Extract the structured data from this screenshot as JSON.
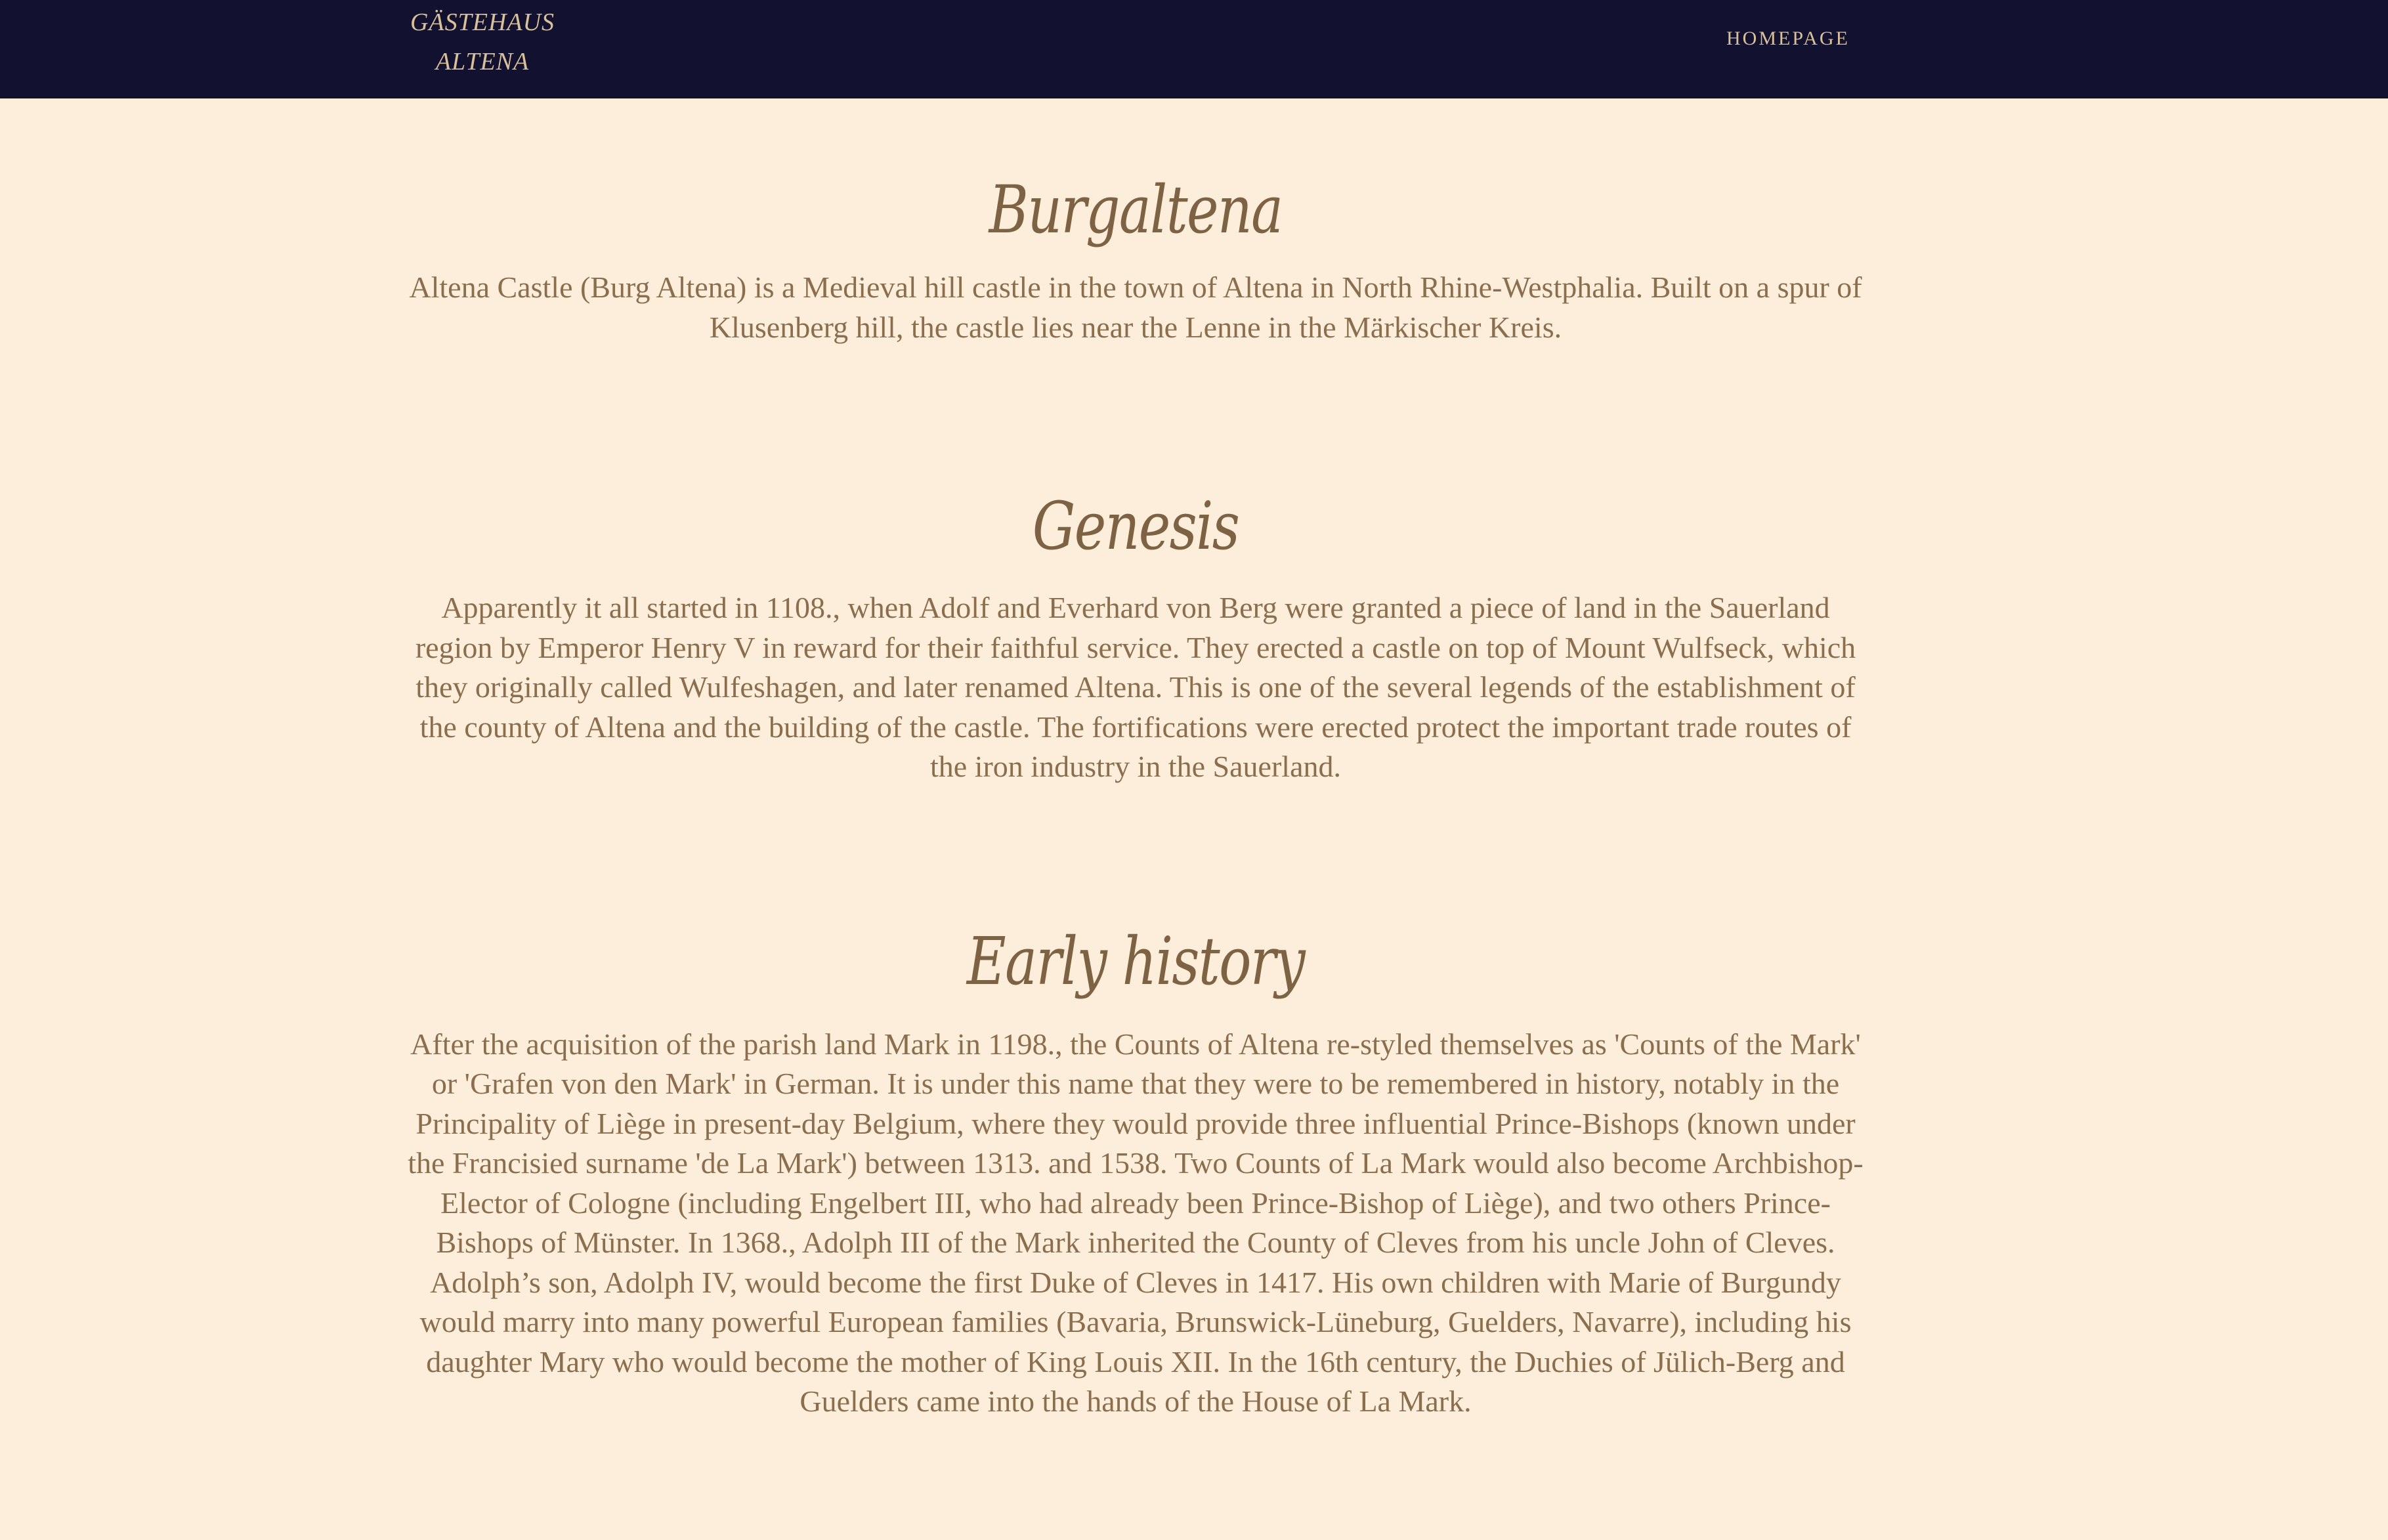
{
  "header": {
    "brand_line1": "GÄSTEHAUS",
    "brand_line2": "ALTENA",
    "nav_home": "HOMEPAGE"
  },
  "colors": {
    "header_bg": "#121130",
    "page_bg": "#fdeedb",
    "text": "#8a6e4d",
    "heading": "#7d6244",
    "header_text": "#d8c19a"
  },
  "sections": [
    {
      "title": "Burgaltena",
      "body": "Altena Castle (Burg Altena) is a Medieval hill castle in the town of Altena in North Rhine-Westphalia. Built on a spur of Klusenberg hill, the castle lies near the Lenne in the Märkischer Kreis."
    },
    {
      "title": "Genesis",
      "body": "Apparently it all started in 1108., when Adolf and Everhard von Berg were granted a piece of land in the Sauerland region by Emperor Henry V in reward for their faithful service. They erected a castle on top of Mount Wulfseck, which they originally called Wulfeshagen, and later renamed Altena. This is one of the several legends of the establishment of the county of Altena and the building of the castle. The fortifications were erected protect the important trade routes of the iron industry in the Sauerland."
    },
    {
      "title": "Early history",
      "body": "After the acquisition of the parish land Mark in 1198., the Counts of Altena re-styled themselves as 'Counts of the Mark' or 'Grafen von den Mark' in German. It is under this name that they were to be remembered in history, notably in the Principality of Liège in present-day Belgium, where they would provide three influential Prince-Bishops (known under the Francisied surname 'de La Mark') between 1313. and 1538. Two Counts of La Mark would also become Archbishop-Elector of Cologne (including Engelbert III, who had already been Prince-Bishop of Liège), and two others Prince-Bishops of Münster. In 1368., Adolph III of the Mark inherited the County of Cleves from his uncle John of Cleves. Adolph’s son, Adolph IV, would become the first Duke of Cleves in 1417. His own children with Marie of Burgundy would marry into many powerful European families (Bavaria, Brunswick-Lüneburg, Guelders, Navarre), including his daughter Mary who would become the mother of King Louis XII. In the 16th century, the Duchies of Jülich-Berg and Guelders came into the hands of the House of La Mark."
    }
  ]
}
